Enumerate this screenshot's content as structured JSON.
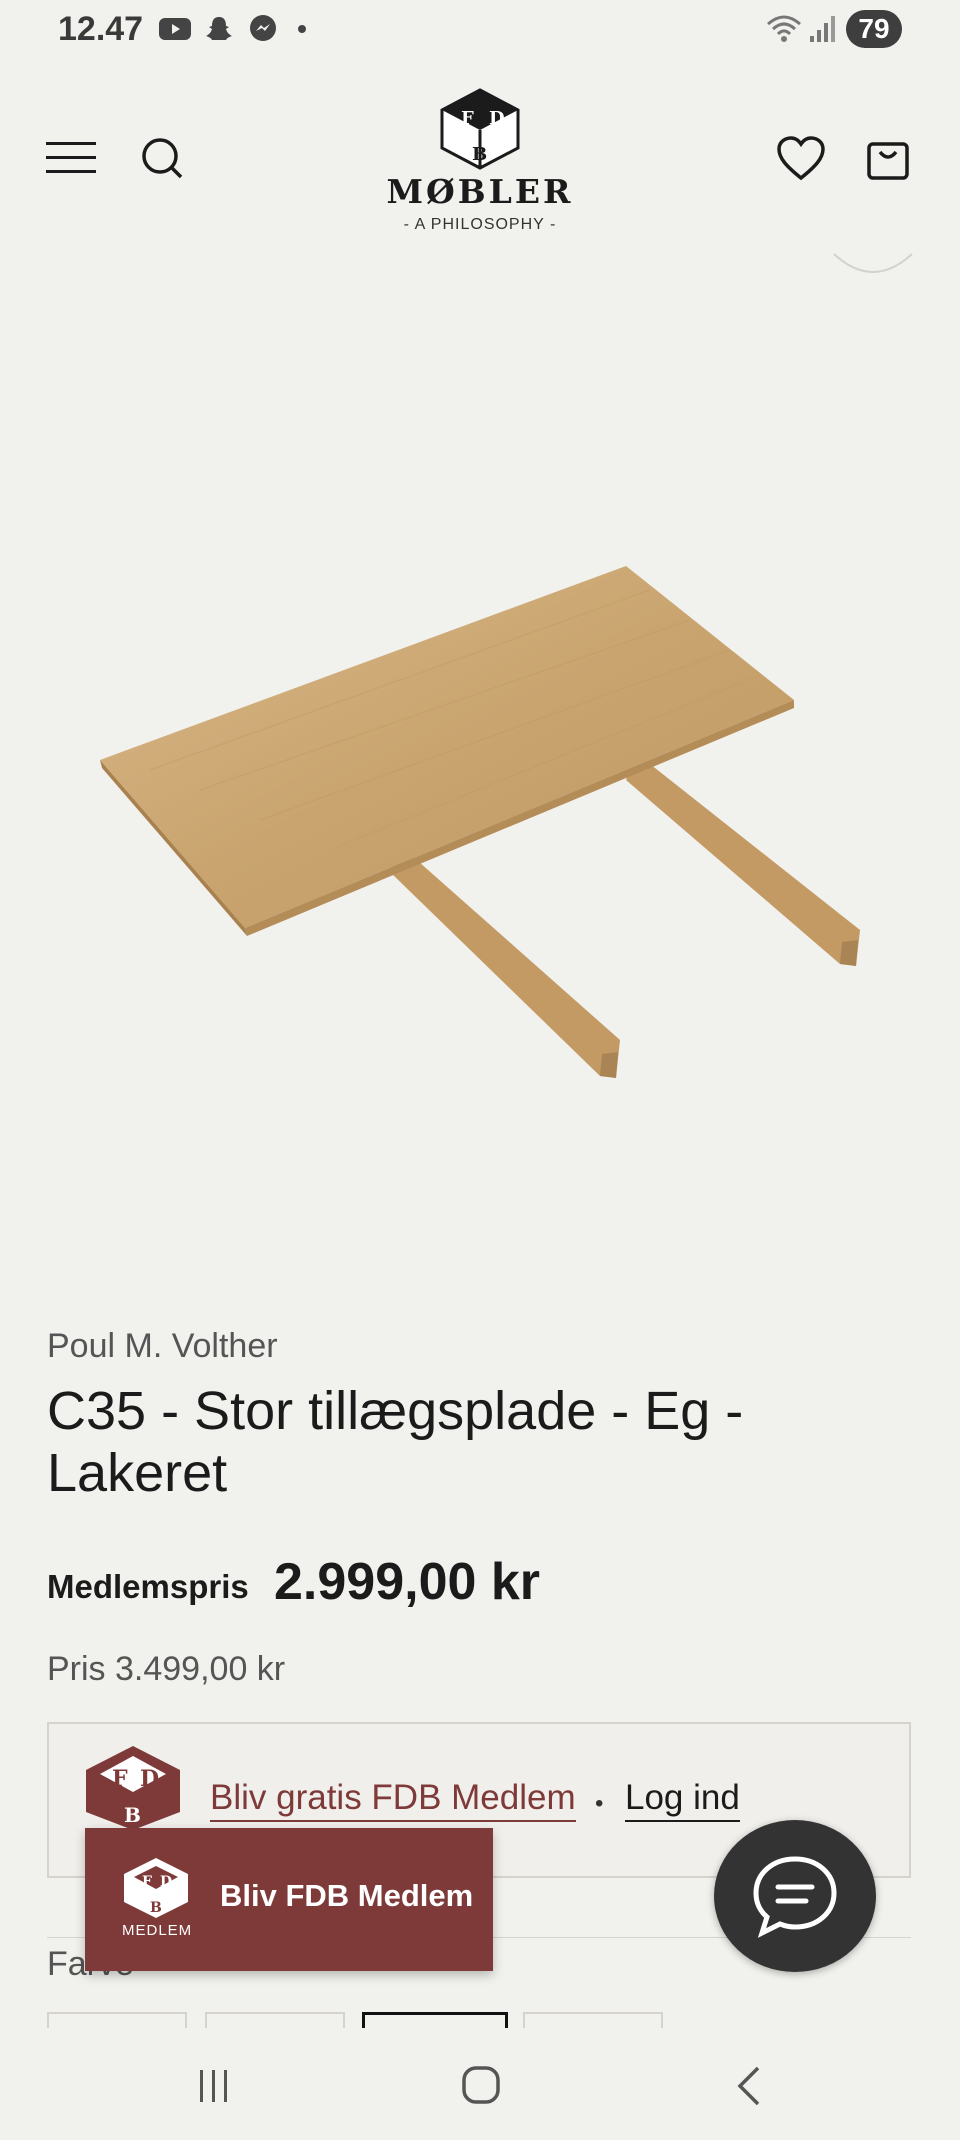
{
  "status_bar": {
    "time": "12.47",
    "battery": "79",
    "icons": [
      "youtube-icon",
      "snapchat-icon",
      "messenger-icon",
      "wifi-icon",
      "signal-icon"
    ]
  },
  "header": {
    "brand": "MØBLER",
    "tagline": "- A PHILOSOPHY -",
    "icons": [
      "menu-icon",
      "search-icon",
      "heart-icon",
      "bag-icon"
    ]
  },
  "product": {
    "designer": "Poul M. Volther",
    "title": "C35 - Stor tillægsplade - Eg - Lakeret",
    "member_label": "Medlemspris",
    "member_price": "2.999,00 kr",
    "regular_price": "Pris 3.499,00 kr"
  },
  "membership": {
    "join_link": "Bliv gratis FDB Medlem",
    "separator": "•",
    "login_link": "Log ind"
  },
  "options": {
    "color_label": "Farve"
  },
  "banner": {
    "label": "Bliv FDB Medlem",
    "badge": "MEDLEM"
  },
  "colors": {
    "accent": "#7e3a39",
    "background": "#f1f1ed",
    "wood": "#c9a36e"
  }
}
